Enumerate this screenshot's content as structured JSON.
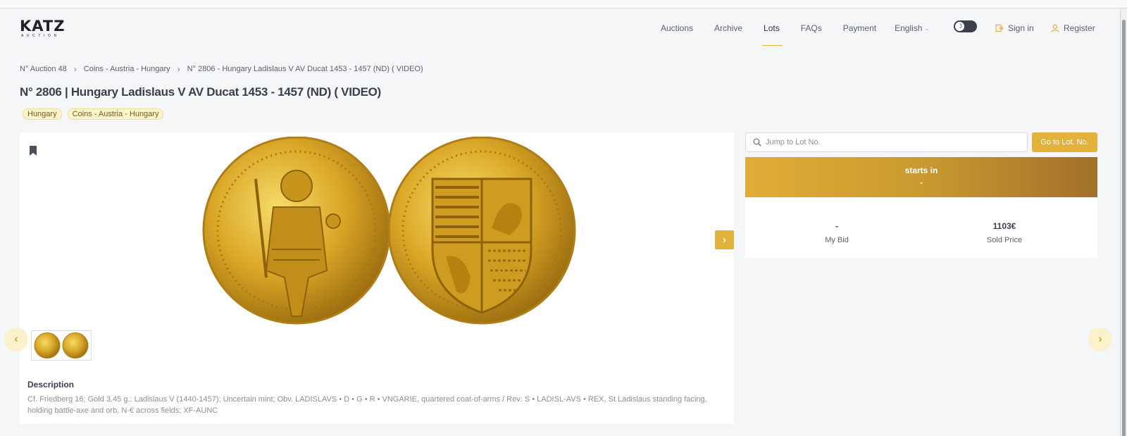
{
  "brand": {
    "name": "KATZ",
    "tagline": "AUCTION"
  },
  "nav": {
    "items": [
      {
        "label": "Auctions",
        "active": false
      },
      {
        "label": "Archive",
        "active": false
      },
      {
        "label": "Lots",
        "active": true
      },
      {
        "label": "FAQs",
        "active": false
      },
      {
        "label": "Payment",
        "active": false
      }
    ],
    "language": "English",
    "sign_in": "Sign in",
    "register": "Register"
  },
  "breadcrumb": [
    "N° Auction 48",
    "Coins - Austria - Hungary",
    "N° 2806 - Hungary Ladislaus V AV Ducat 1453 - 1457 (ND) ( VIDEO)"
  ],
  "lot": {
    "title": "N° 2806 | Hungary Ladislaus V AV Ducat 1453 - 1457 (ND) ( VIDEO)",
    "tags": [
      "Hungary",
      "Coins - Austria - Hungary"
    ],
    "description_title": "Description",
    "description": "Cf. Friedberg 16; Gold 3.45 g.; Ladislaus V (1440-1457); Uncertain mint; Obv. LADISLAVS • D • G • R • VNGARIE, quartered coat-of-arms / Rev: S • LADISL-AVS • REX, St Ladislaus standing facing, holding battle-axe and orb, N-€ across fields; XF-AUNC"
  },
  "sidebar": {
    "jump_placeholder": "Jump to Lot No.",
    "go_button": "Go to Lot. No.",
    "timer_label": "starts in",
    "timer_value": "-",
    "my_bid_value": "-",
    "my_bid_label": "My Bid",
    "sold_price_value": "1103€",
    "sold_price_label": "Sold Price"
  },
  "colors": {
    "accent": "#e3b23c",
    "gold_dark": "#a1702a",
    "text": "#3a3f4c"
  }
}
